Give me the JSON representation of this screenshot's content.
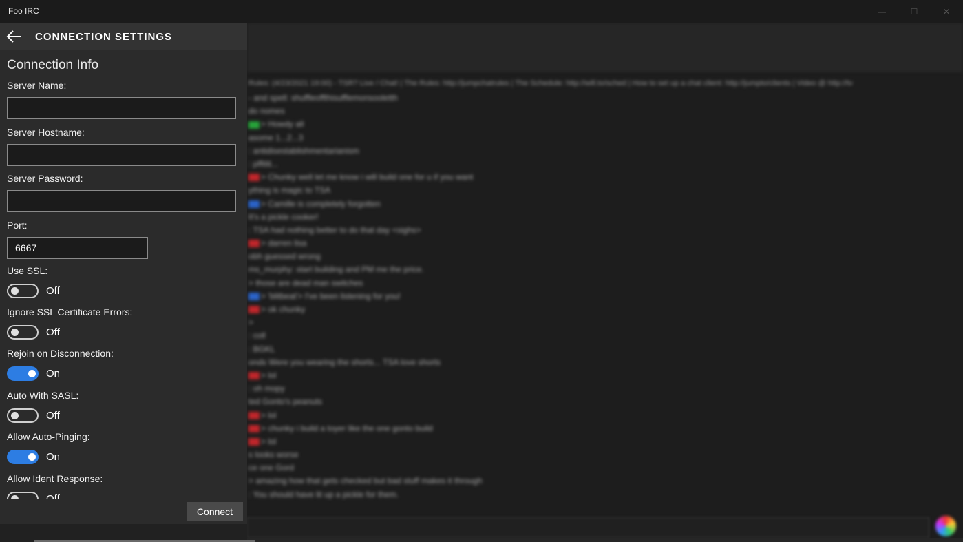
{
  "window": {
    "title": "Foo IRC",
    "minimize": "—",
    "maximize": "☐",
    "close": "✕"
  },
  "panel": {
    "title": "CONNECTION SETTINGS",
    "back_icon": "back-arrow-icon",
    "section": "Connection Info",
    "fields": {
      "server_name": {
        "label": "Server Name:",
        "value": ""
      },
      "server_hostname": {
        "label": "Server Hostname:",
        "value": ""
      },
      "server_password": {
        "label": "Server Password:",
        "value": ""
      },
      "port": {
        "label": "Port:",
        "value": "6667"
      }
    },
    "toggles": {
      "use_ssl": {
        "label": "Use SSL:",
        "state": "Off"
      },
      "ignore_ssl_errors": {
        "label": "Ignore SSL Certificate Errors:",
        "state": "Off"
      },
      "rejoin": {
        "label": "Rejoin on Disconnection:",
        "state": "On"
      },
      "auto_sasl": {
        "label": "Auto With SASL:",
        "state": "Off"
      },
      "auto_pinging": {
        "label": "Allow Auto-Pinging:",
        "state": "On"
      },
      "ident_response": {
        "label": "Allow Ident Response:",
        "state": "Off"
      }
    },
    "connect_label": "Connect",
    "accent_color": "#2d7de3"
  },
  "chat": {
    "topic": "Rules: (4/23/2021 19:00) - TSR? Live / Chat! | The Rules: http://jumpchatrules | The Schedule: http://will.to/sched | How to set up a chat client: http://jumpto/clients | Video @ http://tv",
    "lines": [
      {
        "nick": "none",
        "text": "- and spell: shuffleoffthisufflemonsooletth"
      },
      {
        "nick": "none",
        "text": "do nomes"
      },
      {
        "nick": "green",
        "text": "> Howdy all"
      },
      {
        "nick": "none",
        "text": "asome 1...2...3"
      },
      {
        "nick": "none",
        "text": ": antidisestablishmentarianism"
      },
      {
        "nick": "none",
        "text": ": pfftttt..."
      },
      {
        "nick": "red",
        "text": "> Chunky well let me know i will build one for u if you want"
      },
      {
        "nick": "none",
        "text": "ything is magic to TSA"
      },
      {
        "nick": "blue",
        "text": "> Camille is completely forgotten"
      },
      {
        "nick": "none",
        "text": "It's a pickle cooker!"
      },
      {
        "nick": "none",
        "text": ": TSA had nothing better to do that day <sighs>"
      },
      {
        "nick": "red",
        "text": "> darren lisa"
      },
      {
        "nick": "none",
        "text": "obh guessed wrong"
      },
      {
        "nick": "none",
        "text": "ms_murphy: start building and PM me the price."
      },
      {
        "nick": "none",
        "text": "> those are dead man switches"
      },
      {
        "nick": "blue",
        "text": "> 'blitbeat'> I've been listening for you!"
      },
      {
        "nick": "red",
        "text": "> ok chunky"
      },
      {
        "nick": "none",
        "text": ">"
      },
      {
        "nick": "none",
        "text": ": coll"
      },
      {
        "nick": "none",
        "text": ": BGKL"
      },
      {
        "nick": "none",
        "text": "onds Were you wearing the shorts... TSA love shorts"
      },
      {
        "nick": "red",
        "text": "> lol"
      },
      {
        "nick": "none",
        "text": ": oh mopy"
      },
      {
        "nick": "none",
        "text": "ted Gonto's peanuts"
      },
      {
        "nick": "red",
        "text": "> lol"
      },
      {
        "nick": "red",
        "text": "> chunky i build a toyer like the one gonto build"
      },
      {
        "nick": "red",
        "text": "> lol"
      },
      {
        "nick": "none",
        "text": "s looks worse"
      },
      {
        "nick": "none",
        "text": "ce one Gord"
      },
      {
        "nick": "none",
        "text": "> amazing how that gets checked but bad stuff makes it through"
      },
      {
        "nick": "none",
        "text": ": You should have lit up a pickle for them."
      }
    ]
  }
}
